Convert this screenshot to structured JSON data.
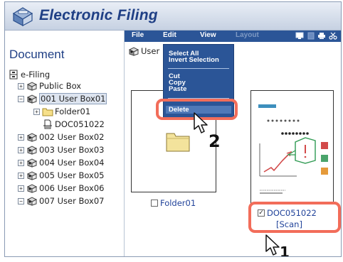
{
  "app": {
    "title": "Electronic Filing"
  },
  "menubar": {
    "file": "File",
    "edit": "Edit",
    "view": "View",
    "layout": "Layout"
  },
  "sidebar": {
    "title": "Document",
    "root": "e-Filing",
    "items": [
      {
        "label": "Public Box"
      },
      {
        "label": "001 User Box01"
      },
      {
        "label": "Folder01"
      },
      {
        "label": "DOC051022"
      },
      {
        "label": "002 User Box02"
      },
      {
        "label": "003 User Box03"
      },
      {
        "label": "004 User Box04"
      },
      {
        "label": "005 User Box05"
      },
      {
        "label": "006 User Box06"
      },
      {
        "label": "007 User Box07"
      }
    ]
  },
  "main": {
    "breadcrumb": "User",
    "folder_card": {
      "label": "Folder01",
      "checked": false
    },
    "doc_card": {
      "label": "DOC051022",
      "sublabel": "[Scan]",
      "checked": true
    }
  },
  "edit_menu": {
    "select_all": "Select All",
    "invert_selection": "Invert Selection",
    "cut": "Cut",
    "copy": "Copy",
    "paste": "Paste",
    "delete": "Delete"
  },
  "callouts": {
    "step1": "1",
    "step2": "2"
  },
  "colors": {
    "brand": "#1f3f85",
    "menubar": "#2b5597",
    "highlight": "#f26d5a",
    "link": "#21439a"
  }
}
